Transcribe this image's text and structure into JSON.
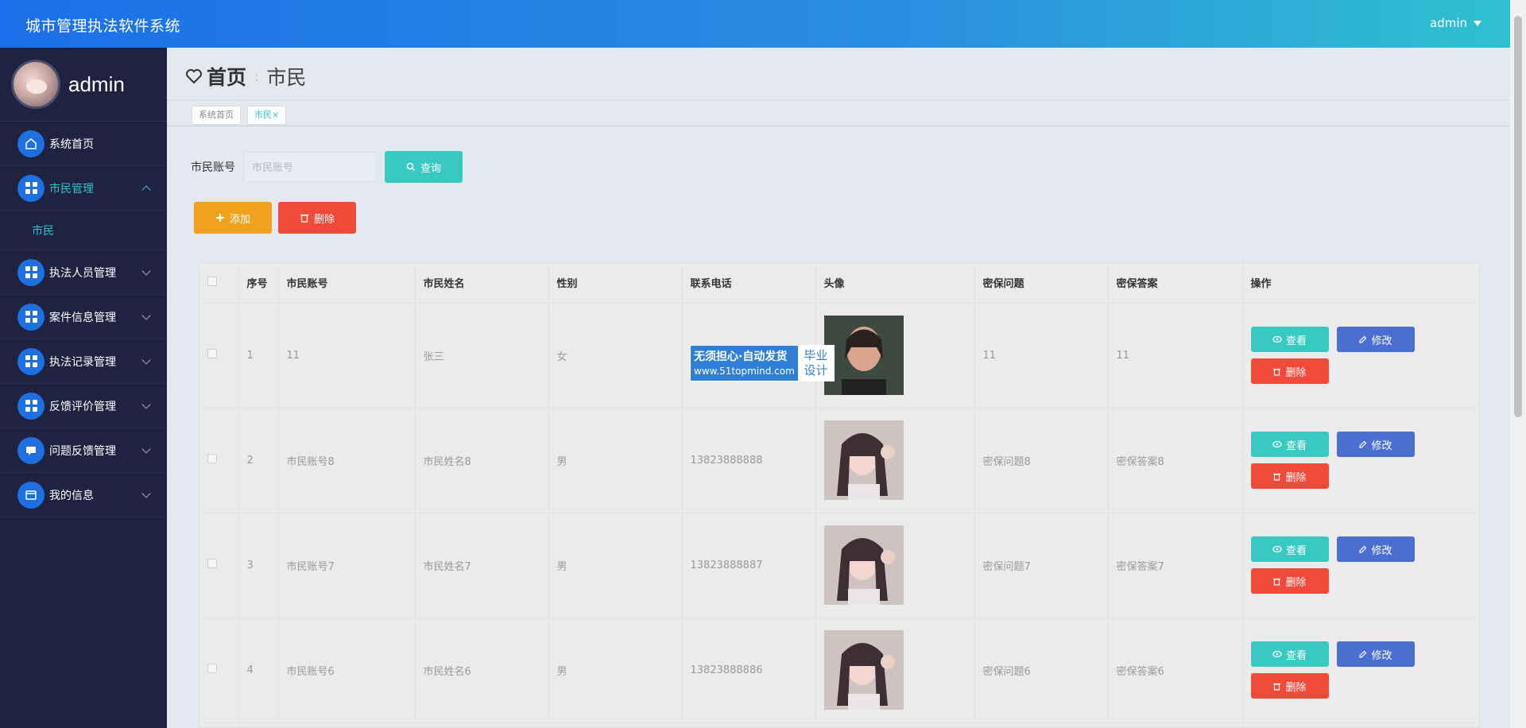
{
  "app": {
    "title": "城市管理执法软件系统",
    "user_menu": "admin"
  },
  "sidebar": {
    "profile_name": "admin",
    "items": [
      {
        "label": "系统首页",
        "icon": "home-icon",
        "state": "none"
      },
      {
        "label": "市民管理",
        "icon": "grid-icon",
        "state": "expanded"
      },
      {
        "label": "执法人员管理",
        "icon": "grid-icon",
        "state": "collapsed"
      },
      {
        "label": "案件信息管理",
        "icon": "grid-icon",
        "state": "collapsed"
      },
      {
        "label": "执法记录管理",
        "icon": "grid-icon",
        "state": "collapsed"
      },
      {
        "label": "反馈评价管理",
        "icon": "grid-icon",
        "state": "collapsed"
      },
      {
        "label": "问题反馈管理",
        "icon": "chat-icon",
        "state": "collapsed"
      },
      {
        "label": "我的信息",
        "icon": "card-icon",
        "state": "collapsed"
      }
    ],
    "submenu": {
      "label": "市民"
    }
  },
  "breadcrumb": {
    "home": "首页",
    "separator": ":",
    "current": "市民"
  },
  "tags": [
    {
      "label": "系统首页",
      "active": false
    },
    {
      "label": "市民",
      "active": true,
      "close": "×"
    }
  ],
  "search": {
    "label": "市民账号",
    "placeholder": "市民账号",
    "value": "",
    "button": "查询"
  },
  "actions": {
    "add": "添加",
    "delete": "删除"
  },
  "table": {
    "headers": [
      "序号",
      "市民账号",
      "市民姓名",
      "性别",
      "联系电话",
      "头像",
      "密保问题",
      "密保答案",
      "操作"
    ],
    "rows": [
      {
        "index": "1",
        "account": "11",
        "name": "张三",
        "gender": "女",
        "phone": "",
        "question": "11",
        "answer": "11",
        "photo": "portrait-dark"
      },
      {
        "index": "2",
        "account": "市民账号8",
        "name": "市民姓名8",
        "gender": "男",
        "phone": "13823888888",
        "question": "密保问题8",
        "answer": "密保答案8",
        "photo": "portrait-light"
      },
      {
        "index": "3",
        "account": "市民账号7",
        "name": "市民姓名7",
        "gender": "男",
        "phone": "13823888887",
        "question": "密保问题7",
        "answer": "密保答案7",
        "photo": "portrait-light"
      },
      {
        "index": "4",
        "account": "市民账号6",
        "name": "市民姓名6",
        "gender": "男",
        "phone": "13823888886",
        "question": "密保问题6",
        "answer": "密保答案6",
        "photo": "portrait-light"
      }
    ],
    "row_buttons": {
      "view": "查看",
      "edit": "修改",
      "delete": "删除"
    }
  },
  "watermark": {
    "line1": "无须担心·自动发货",
    "line2": "www.51topmind.com",
    "badge_top": "毕业",
    "badge_bottom": "设计"
  },
  "colors": {
    "topbar_start": "#1b6fe8",
    "topbar_end": "#2ec3cf",
    "sidebar": "#1f2240",
    "accent": "#2ec3cf",
    "warning": "#f0a21c",
    "danger": "#f24a3a",
    "primary": "#4b6fd0"
  }
}
